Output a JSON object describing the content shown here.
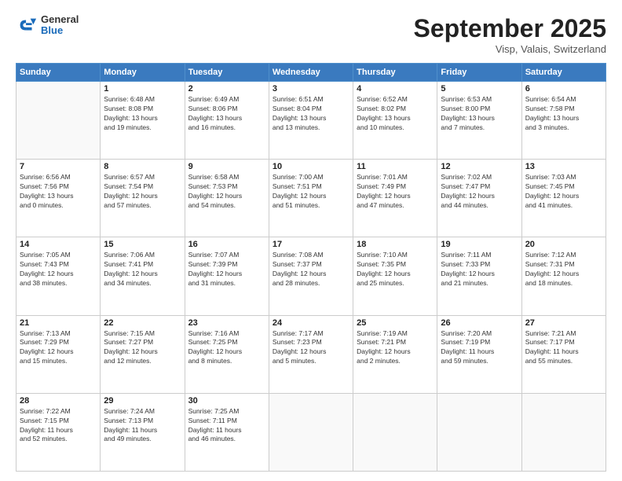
{
  "header": {
    "logo_general": "General",
    "logo_blue": "Blue",
    "month": "September 2025",
    "location": "Visp, Valais, Switzerland"
  },
  "weekdays": [
    "Sunday",
    "Monday",
    "Tuesday",
    "Wednesday",
    "Thursday",
    "Friday",
    "Saturday"
  ],
  "weeks": [
    [
      {
        "day": "",
        "info": ""
      },
      {
        "day": "1",
        "info": "Sunrise: 6:48 AM\nSunset: 8:08 PM\nDaylight: 13 hours\nand 19 minutes."
      },
      {
        "day": "2",
        "info": "Sunrise: 6:49 AM\nSunset: 8:06 PM\nDaylight: 13 hours\nand 16 minutes."
      },
      {
        "day": "3",
        "info": "Sunrise: 6:51 AM\nSunset: 8:04 PM\nDaylight: 13 hours\nand 13 minutes."
      },
      {
        "day": "4",
        "info": "Sunrise: 6:52 AM\nSunset: 8:02 PM\nDaylight: 13 hours\nand 10 minutes."
      },
      {
        "day": "5",
        "info": "Sunrise: 6:53 AM\nSunset: 8:00 PM\nDaylight: 13 hours\nand 7 minutes."
      },
      {
        "day": "6",
        "info": "Sunrise: 6:54 AM\nSunset: 7:58 PM\nDaylight: 13 hours\nand 3 minutes."
      }
    ],
    [
      {
        "day": "7",
        "info": "Sunrise: 6:56 AM\nSunset: 7:56 PM\nDaylight: 13 hours\nand 0 minutes."
      },
      {
        "day": "8",
        "info": "Sunrise: 6:57 AM\nSunset: 7:54 PM\nDaylight: 12 hours\nand 57 minutes."
      },
      {
        "day": "9",
        "info": "Sunrise: 6:58 AM\nSunset: 7:53 PM\nDaylight: 12 hours\nand 54 minutes."
      },
      {
        "day": "10",
        "info": "Sunrise: 7:00 AM\nSunset: 7:51 PM\nDaylight: 12 hours\nand 51 minutes."
      },
      {
        "day": "11",
        "info": "Sunrise: 7:01 AM\nSunset: 7:49 PM\nDaylight: 12 hours\nand 47 minutes."
      },
      {
        "day": "12",
        "info": "Sunrise: 7:02 AM\nSunset: 7:47 PM\nDaylight: 12 hours\nand 44 minutes."
      },
      {
        "day": "13",
        "info": "Sunrise: 7:03 AM\nSunset: 7:45 PM\nDaylight: 12 hours\nand 41 minutes."
      }
    ],
    [
      {
        "day": "14",
        "info": "Sunrise: 7:05 AM\nSunset: 7:43 PM\nDaylight: 12 hours\nand 38 minutes."
      },
      {
        "day": "15",
        "info": "Sunrise: 7:06 AM\nSunset: 7:41 PM\nDaylight: 12 hours\nand 34 minutes."
      },
      {
        "day": "16",
        "info": "Sunrise: 7:07 AM\nSunset: 7:39 PM\nDaylight: 12 hours\nand 31 minutes."
      },
      {
        "day": "17",
        "info": "Sunrise: 7:08 AM\nSunset: 7:37 PM\nDaylight: 12 hours\nand 28 minutes."
      },
      {
        "day": "18",
        "info": "Sunrise: 7:10 AM\nSunset: 7:35 PM\nDaylight: 12 hours\nand 25 minutes."
      },
      {
        "day": "19",
        "info": "Sunrise: 7:11 AM\nSunset: 7:33 PM\nDaylight: 12 hours\nand 21 minutes."
      },
      {
        "day": "20",
        "info": "Sunrise: 7:12 AM\nSunset: 7:31 PM\nDaylight: 12 hours\nand 18 minutes."
      }
    ],
    [
      {
        "day": "21",
        "info": "Sunrise: 7:13 AM\nSunset: 7:29 PM\nDaylight: 12 hours\nand 15 minutes."
      },
      {
        "day": "22",
        "info": "Sunrise: 7:15 AM\nSunset: 7:27 PM\nDaylight: 12 hours\nand 12 minutes."
      },
      {
        "day": "23",
        "info": "Sunrise: 7:16 AM\nSunset: 7:25 PM\nDaylight: 12 hours\nand 8 minutes."
      },
      {
        "day": "24",
        "info": "Sunrise: 7:17 AM\nSunset: 7:23 PM\nDaylight: 12 hours\nand 5 minutes."
      },
      {
        "day": "25",
        "info": "Sunrise: 7:19 AM\nSunset: 7:21 PM\nDaylight: 12 hours\nand 2 minutes."
      },
      {
        "day": "26",
        "info": "Sunrise: 7:20 AM\nSunset: 7:19 PM\nDaylight: 11 hours\nand 59 minutes."
      },
      {
        "day": "27",
        "info": "Sunrise: 7:21 AM\nSunset: 7:17 PM\nDaylight: 11 hours\nand 55 minutes."
      }
    ],
    [
      {
        "day": "28",
        "info": "Sunrise: 7:22 AM\nSunset: 7:15 PM\nDaylight: 11 hours\nand 52 minutes."
      },
      {
        "day": "29",
        "info": "Sunrise: 7:24 AM\nSunset: 7:13 PM\nDaylight: 11 hours\nand 49 minutes."
      },
      {
        "day": "30",
        "info": "Sunrise: 7:25 AM\nSunset: 7:11 PM\nDaylight: 11 hours\nand 46 minutes."
      },
      {
        "day": "",
        "info": ""
      },
      {
        "day": "",
        "info": ""
      },
      {
        "day": "",
        "info": ""
      },
      {
        "day": "",
        "info": ""
      }
    ]
  ]
}
